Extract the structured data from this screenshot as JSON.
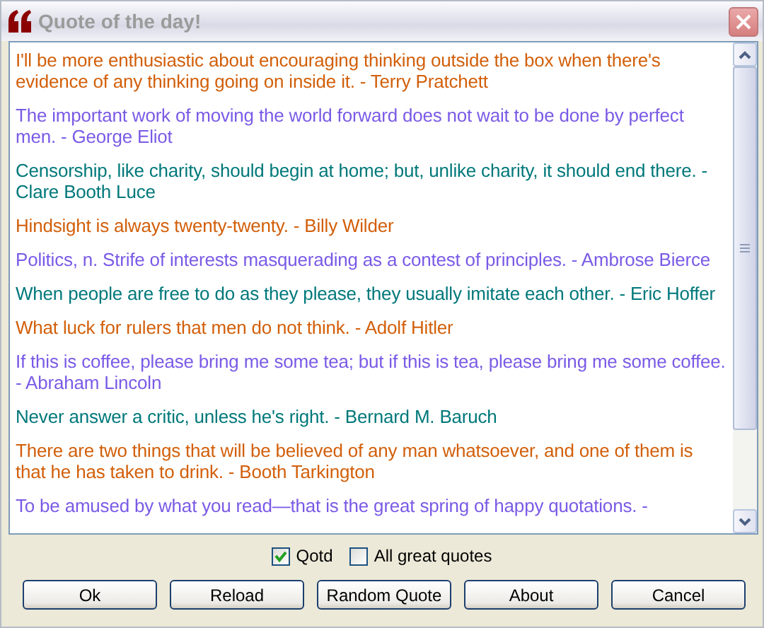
{
  "window": {
    "title": "Quote of the day!"
  },
  "quotes": [
    {
      "text": "I'll be more enthusiastic about encouraging thinking outside the box when there's evidence of any thinking going on inside it. - Terry Pratchett",
      "color": "#d25f0a"
    },
    {
      "text": "The important work of moving the world forward does not wait to be done by perfect men. - George Eliot",
      "color": "#7a5ae6"
    },
    {
      "text": "Censorship, like charity, should begin at home; but, unlike charity, it should end there. - Clare Booth Luce",
      "color": "#00787a"
    },
    {
      "text": "Hindsight is always twenty-twenty. - Billy Wilder",
      "color": "#d25f0a"
    },
    {
      "text": "Politics, n. Strife of interests masquerading as a contest of principles. - Ambrose Bierce",
      "color": "#7a5ae6"
    },
    {
      "text": "When people are free to do as they please, they usually imitate each other. - Eric Hoffer",
      "color": "#00787a"
    },
    {
      "text": "What luck for rulers that men do not think. - Adolf Hitler",
      "color": "#d25f0a"
    },
    {
      "text": "If this is coffee, please bring me some tea; but if this is tea, please bring me some coffee. - Abraham Lincoln",
      "color": "#7a5ae6"
    },
    {
      "text": "Never answer a critic, unless he's right. - Bernard M. Baruch",
      "color": "#00787a"
    },
    {
      "text": "There are two things that will be believed of any man whatsoever, and one of them is that he has taken to drink. - Booth Tarkington",
      "color": "#d25f0a"
    },
    {
      "text": "To be amused by what you read—that is the great spring of happy quotations. -",
      "color": "#7a5ae6"
    }
  ],
  "options": [
    {
      "label": "Qotd",
      "checked": true
    },
    {
      "label": "All great quotes",
      "checked": false
    }
  ],
  "buttons": [
    "Ok",
    "Reload",
    "Random Quote",
    "About",
    "Cancel"
  ]
}
